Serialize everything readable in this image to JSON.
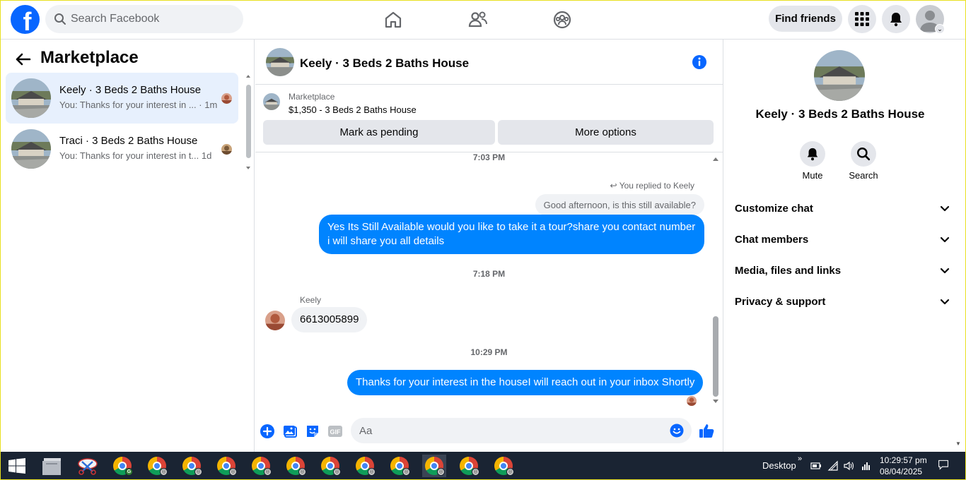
{
  "header": {
    "logo_letter": "f",
    "search_placeholder": "Search Facebook",
    "find_friends_label": "Find friends",
    "nav_icons": [
      "home-icon",
      "friends-icon",
      "groups-icon"
    ],
    "right_icons": [
      "menu-grid-icon",
      "notifications-icon",
      "account-avatar-icon"
    ]
  },
  "sidebar": {
    "title": "Marketplace",
    "conversations": [
      {
        "name": "Keely · 3 Beds 2 Baths House",
        "snippet": "You: Thanks for your interest in ...",
        "time": "· 1m",
        "active": true
      },
      {
        "name": "Traci · 3 Beds 2 Baths House",
        "snippet": "You: Thanks for your interest in t...",
        "time": "1d",
        "active": false
      }
    ]
  },
  "chat": {
    "title": "Keely · 3 Beds 2 Baths House",
    "listing": {
      "label": "Marketplace",
      "price_title": "$1,350 - 3 Beds 2 Baths House",
      "mark_pending_label": "Mark as pending",
      "more_options_label": "More options"
    },
    "timestamps": [
      "7:03 PM",
      "7:18 PM",
      "10:29 PM"
    ],
    "replied_note": "You replied to Keely",
    "quoted_text": "Good afternoon, is this still available?",
    "message_out_1": "Yes Its Still Available would you like to take it a tour?share you contact number i will share you all details",
    "sender_name": "Keely",
    "message_in_1": "6613005899",
    "message_out_2": "Thanks for your interest in the houseI will reach out in your inbox Shortly",
    "composer_placeholder": "Aa"
  },
  "info_panel": {
    "name": "Keely · 3 Beds 2 Baths House",
    "actions": [
      {
        "label": "Mute",
        "icon": "bell-icon"
      },
      {
        "label": "Search",
        "icon": "search-icon"
      }
    ],
    "sections": [
      "Customize chat",
      "Chat members",
      "Media, files and links",
      "Privacy & support"
    ]
  },
  "taskbar": {
    "desktop_label": "Desktop",
    "time": "10:29:57 pm",
    "date": "08/04/2025",
    "pinned": [
      "start-icon",
      "file-explorer-icon",
      "snipping-tool-icon",
      "chrome-icon"
    ]
  },
  "colors": {
    "brand": "#0866ff",
    "bubble": "#0084ff",
    "taskbar": "#1a2433"
  }
}
